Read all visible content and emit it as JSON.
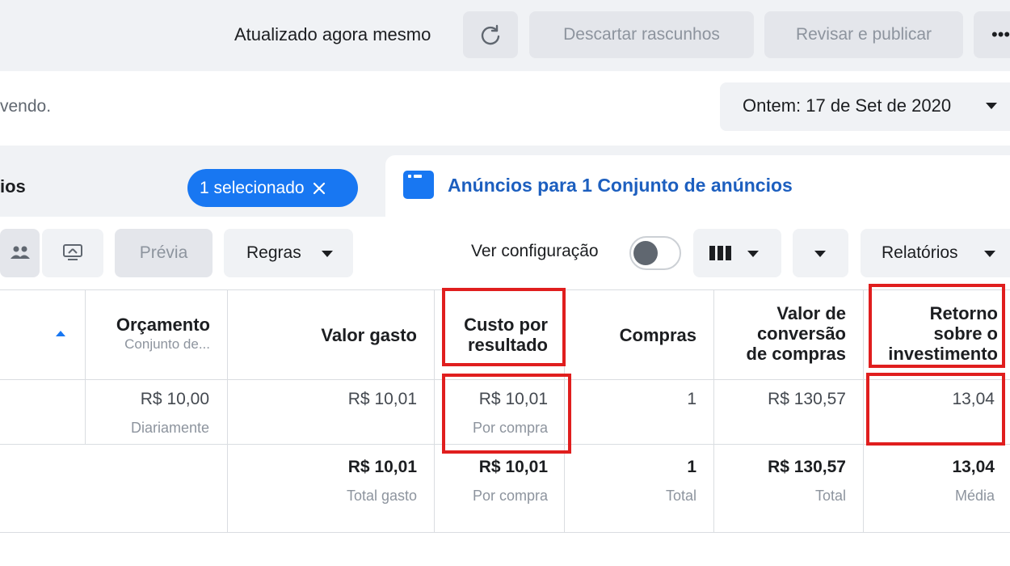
{
  "header": {
    "updated_text": "Atualizado agora mesmo",
    "discard_label": "Descartar rascunhos",
    "review_label": "Revisar e publicar",
    "more_label": "•••"
  },
  "subheader": {
    "partial_text": "vendo.",
    "date_label": "Ontem: 17 de Set de 2020"
  },
  "tabs": {
    "left_label": "ios",
    "selected_pill": "1 selecionado",
    "active_label": "Anúncios para 1 Conjunto de anúncios"
  },
  "toolbar": {
    "preview_label": "Prévia",
    "rules_label": "Regras",
    "view_config_label": "Ver configuração",
    "view_config_on": false,
    "reports_label": "Relatórios"
  },
  "table": {
    "headers": {
      "budget": "Orçamento",
      "budget_sub": "Conjunto de...",
      "spent": "Valor gasto",
      "cost_line1": "Custo por",
      "cost_line2": "resultado",
      "purchases": "Compras",
      "conv_line1": "Valor de",
      "conv_line2": "conversão",
      "conv_line3": "de compras",
      "roas_line1": "Retorno",
      "roas_line2": "sobre o",
      "roas_line3": "investimento"
    },
    "row": {
      "budget": "R$ 10,00",
      "budget_sub": "Diariamente",
      "spent": "R$ 10,01",
      "cost": "R$ 10,01",
      "cost_sub": "Por compra",
      "purchases": "1",
      "conv": "R$ 130,57",
      "roas": "13,04"
    },
    "totals": {
      "spent": "R$ 10,01",
      "spent_sub": "Total gasto",
      "cost": "R$ 10,01",
      "cost_sub": "Por compra",
      "purchases": "1",
      "purchases_sub": "Total",
      "conv": "R$ 130,57",
      "conv_sub": "Total",
      "roas": "13,04",
      "roas_sub": "Média"
    }
  },
  "colors": {
    "accent": "#1877f2",
    "highlight": "#e01e1e",
    "tab_text": "#1d5fbf"
  },
  "icons": [
    "refresh-icon",
    "close-icon",
    "ads-icon",
    "people-icon",
    "share-icon",
    "caret-down-icon",
    "columns-icon",
    "sort-up-icon"
  ]
}
